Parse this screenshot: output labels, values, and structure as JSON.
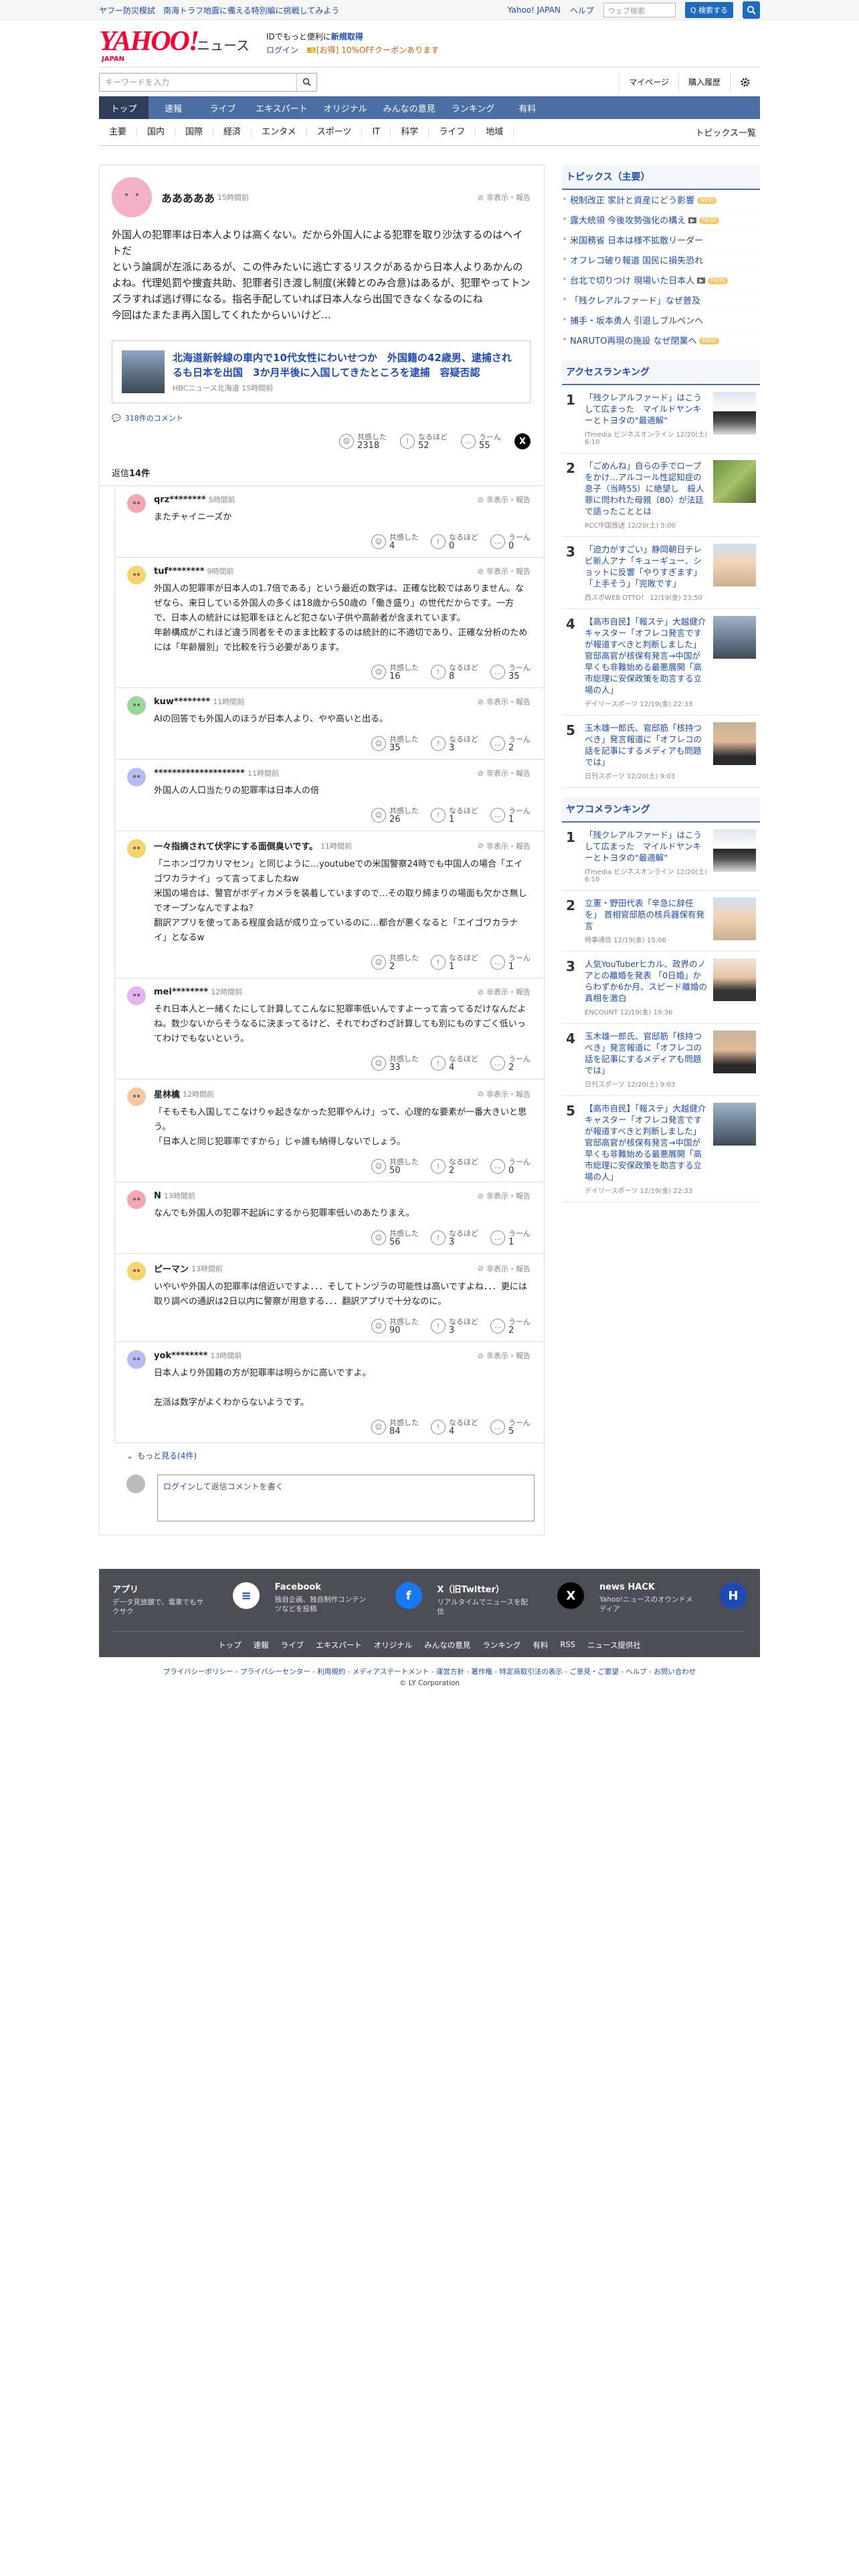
{
  "top_strip": {
    "promo_link": "ヤフー防災模試　南海トラフ地震に備える特別編に挑戦してみよう",
    "yahoo_japan": "Yahoo! JAPAN",
    "help": "ヘルプ",
    "search_placeholder": "ウェブ検索",
    "search_button": "Q 検索する"
  },
  "header": {
    "logo": "YAHOO!",
    "logo_sub": "JAPAN",
    "site": "ニュース",
    "promo_line1_prefix": "IDでもっと便利に",
    "promo_line1_link": "新規取得",
    "promo_line2_login": "ログイン",
    "promo_line2_coupon": "[お得] 10%OFFクーポンあります"
  },
  "toolbar": {
    "keyword_placeholder": "キーワードを入力",
    "mypage": "マイページ",
    "purchase_history": "購入履歴"
  },
  "global_nav": [
    "トップ",
    "速報",
    "ライブ",
    "エキスパート",
    "オリジナル",
    "みんなの意見",
    "ランキング",
    "有料"
  ],
  "sub_nav": [
    "主要",
    "国内",
    "国際",
    "経済",
    "エンタメ",
    "スポーツ",
    "IT",
    "科学",
    "ライフ",
    "地域"
  ],
  "sub_nav_topics": "トピックス一覧",
  "post": {
    "user": "あああああ",
    "time": "15時間前",
    "report": "非表示・報告",
    "text": "外国人の犯罪率は日本人よりは高くない。だから外国人による犯罪を取り沙汰するのはヘイトだ\nという論調が左派にあるが、この件みたいに逃亡するリスクがあるから日本人よりあかんのよね。代理処罰や捜査共助、犯罪者引き渡し制度(米韓とのみ合意)はあるが、犯罪やってトンズラすれば逃げ得になる。指名手配していれば日本人なら出国できなくなるのにね\n今回はたまたま再入国してくれたからいいけど…",
    "article_title": "北海道新幹線の車内で10代女性にわいせつか　外国籍の42歳男、逮捕されるも日本を出国　3か月半後に入国してきたところを逮捕　容疑否認",
    "article_source": "HBCニュース北海道 15時間前",
    "article_comments": "318件のコメント",
    "reactions": [
      {
        "label": "共感した",
        "count": "2318",
        "icon": "smile-icon"
      },
      {
        "label": "なるほど",
        "count": "52",
        "icon": "bulb-icon"
      },
      {
        "label": "うーん",
        "count": "55",
        "icon": "hmm-icon"
      }
    ]
  },
  "reply_count_label": "返信",
  "reply_count": "14件",
  "replies": [
    {
      "user": "qrz********",
      "time": "5時間前",
      "text": "またチャイニーズか",
      "counts": [
        "4",
        "0",
        "0"
      ],
      "color": "#f3a6b6"
    },
    {
      "user": "tuf********",
      "time": "9時間前",
      "text": "外国人の犯罪率が日本人の1.7倍である」という最近の数字は、正確な比較ではありません。なぜなら、来日している外国人の多くは18歳から50歳の「働き盛り」の世代だからです。一方で、日本人の統計には犯罪をほとんど犯さない子供や高齢者が含まれています。\n年齢構成がこれほど違う同者をそのまま比較するのは統計的に不適切であり、正確な分析のためには「年齢層別」で比較を行う必要があります。",
      "counts": [
        "16",
        "8",
        "35"
      ],
      "color": "#f7d36d"
    },
    {
      "user": "kuw********",
      "time": "11時間前",
      "text": "AIの回答でも外国人のほうが日本人より、やや高いと出る。",
      "counts": [
        "35",
        "3",
        "2"
      ],
      "color": "#9ad89a"
    },
    {
      "user": "********************",
      "time": "11時間前",
      "text": "外国人の人口当たりの犯罪率は日本人の倍",
      "counts": [
        "26",
        "1",
        "1"
      ],
      "color": "#b6bcf2"
    },
    {
      "user": "一々指摘されて伏字にする面倒臭いです。",
      "time": "11時間前",
      "text": "「ニホンゴワカリマセン」と同じように…youtubeでの米国警察24時でも中国人の場合「エイゴワカラナイ」って言ってましたねw\n米国の場合は、警官がボディカメラを装着していますので…その取り締まりの場面も欠かさ無しでオープンなんですよね？\n翻訳アプリを使ってある程度会話が成り立っているのに…都合が悪くなると「エイゴワカラナイ」となるw",
      "counts": [
        "2",
        "1",
        "1"
      ],
      "color": "#f7d36d"
    },
    {
      "user": "mei********",
      "time": "12時間前",
      "text": "それ日本人と一緒くたにして計算してこんなに犯罪率低いんですよーって言ってるだけなんだよね。数少ないからそうなるに決まってるけど、それでわざわざ計算しても別にものすごく低いってわけでもないという。",
      "counts": [
        "33",
        "4",
        "2"
      ],
      "color": "#e6b3f0"
    },
    {
      "user": "星林檎",
      "time": "12時間前",
      "text": "「そもそも入国してこなけりゃ起きなかった犯罪やんけ」って、心理的な要素が一番大きいと思う。\n「日本人と同じ犯罪率ですから」じゃ誰も納得しないでしょう。",
      "counts": [
        "50",
        "2",
        "0"
      ],
      "color": "#f5c9a6"
    },
    {
      "user": "N",
      "time": "13時間前",
      "text": "なんでも外国人の犯罪不起訴にするから犯罪率低いのあたりまえ。",
      "counts": [
        "56",
        "3",
        "1"
      ],
      "color": "#f3a6b6"
    },
    {
      "user": "ピーマン",
      "time": "13時間前",
      "text": "いやいや外国人の犯罪率は倍近いですよ．．．そしてトンヅラの可能性は高いですよね．．．更には取り調べの通訳は2日以内に警察が用意する．．．翻訳アプリで十分なのに。",
      "counts": [
        "90",
        "3",
        "2"
      ],
      "color": "#f7d36d"
    },
    {
      "user": "yok********",
      "time": "13時間前",
      "text": "日本人より外国籍の方が犯罪率は明らかに高いですよ。\n\n左派は数字がよくわからないようです。",
      "counts": [
        "84",
        "4",
        "5"
      ],
      "color": "#b6bcf2"
    }
  ],
  "reaction_labels": [
    "共感した",
    "なるほど",
    "うーん"
  ],
  "more_replies": "もっと見る(4件)",
  "comment_box": {
    "login": "ログイン",
    "text": "して返信コメントを書く"
  },
  "right": {
    "topics_title": "トピックス（主要）",
    "topics": [
      {
        "text": "税制改正 家計と資産にどう影響",
        "badge": "new"
      },
      {
        "text": "露大統領 今後攻勢強化の構え",
        "badge": "new-cam"
      },
      {
        "text": "米国務省 日本は様不拡散リーダー",
        "badge": ""
      },
      {
        "text": "オフレコ破り報道 国民に損失恐れ",
        "badge": ""
      },
      {
        "text": "台北で切りつけ 現場いた日本人",
        "badge": "new-cam"
      },
      {
        "text": "「残クレアルファード」なぜ普及",
        "badge": ""
      },
      {
        "text": "捕手・坂本勇人 引退しブルペンへ",
        "badge": ""
      },
      {
        "text": "NARUTO再現の施設 なぜ閉業へ",
        "badge": "new"
      }
    ],
    "access_title": "アクセスランキング",
    "access": [
      {
        "rank": "1",
        "title": "「残クレアルファード」はこうして広まった　マイルドヤンキーとトヨタの\"最適解\"",
        "src": "ITmedia ビジネスオンライン 12/20(土) 6:10",
        "img": "car"
      },
      {
        "rank": "2",
        "title": "「ごめんね」自らの手でロープをかけ…アルコール性認知症の息子（当時55）に絶望し　殺人罪に問われた母親（80）が法廷で語ったこととは",
        "src": "RCC中国放送 12/20(土) 5:00",
        "img": "green"
      },
      {
        "rank": "3",
        "title": "「迫力がすごい」静岡朝日テレビ新人アナ「キューギュー、ショットに反響「やりすぎます」「上手そう」「完敗です」",
        "src": "西スポWEB OTTO！ 12/19(金) 23:50",
        "img": "person"
      },
      {
        "rank": "4",
        "title": "【高市自民】「報ステ」大越健介キャスター「オフレコ発言ですが報道すべきと判断しました」官邸高官が核保有発言→中国が早くも非難始める最悪展開「高市総理に安保政策を助言する立場の人」",
        "src": "デイリースポーツ 12/19(金) 22:33",
        "img": "building"
      },
      {
        "rank": "5",
        "title": "玉木雄一郎氏、官邸筋「核持つべき」発言報道に「オフレコの話を記事にするメディアも問題では」",
        "src": "日刊スポーツ 12/20(土) 9:03",
        "img": "face"
      }
    ],
    "comment_title": "ヤフコメランキング",
    "comment": [
      {
        "rank": "1",
        "title": "「残クレアルファード」はこうして広まった　マイルドヤンキーとトヨタの\"最適解\"",
        "src": "ITmedia ビジネスオンライン 12/20(土) 6:10",
        "img": "car"
      },
      {
        "rank": "2",
        "title": "立憲・野田代表「辛急に辞任を」 首相官邸筋の核兵器保有発言",
        "src": "時事通信 12/19(金) 15:06",
        "img": "person"
      },
      {
        "rank": "3",
        "title": "人気YouTuberヒカル、政界のノアとの離婚を発表 「0日婚」からわずか6か月、スピード離婚の真相を激白",
        "src": "ENCOUNT 12/19(金) 19:36",
        "img": "person2"
      },
      {
        "rank": "4",
        "title": "玉木雄一郎氏、官邸筋「核持つべき」発言報道に「オフレコの話を記事にするメディアも問題では」",
        "src": "日刊スポーツ 12/20(土) 9:03",
        "img": "face"
      },
      {
        "rank": "5",
        "title": "【高市自民】「報ステ」大越健介キャスター「オフレコ発言ですが報道すべきと判断しました」官邸高官が核保有発言→中国が早くも非難始める最悪展開「高市総理に安保政策を助言する立場の人」",
        "src": "デイリースポーツ 12/19(金) 22:33",
        "img": "building"
      }
    ]
  },
  "footer": {
    "cols": [
      {
        "title": "アプリ",
        "desc": "データ見放題で、電車でもサクサク",
        "icon": "app-icon",
        "glyph": "≡"
      },
      {
        "title": "Facebook",
        "desc": "独自企画、独自制作コンテンツなどを投稿",
        "icon": "facebook-icon",
        "glyph": "f"
      },
      {
        "title": "X（旧Twitter）",
        "desc": "リアルタイムでニュースを配信",
        "icon": "x-icon",
        "glyph": "X"
      },
      {
        "title": "news HACK",
        "desc": "Yahoo!ニュースのオウンドメディア",
        "icon": "newshack-icon",
        "glyph": "H"
      }
    ],
    "links": [
      "トップ",
      "速報",
      "ライブ",
      "エキスパート",
      "オリジナル",
      "みんなの意見",
      "ランキング",
      "有料",
      "RSS",
      "ニュース提供社"
    ],
    "legal": "プライバシーポリシー - プライバシーセンター - 利用規約 - メディアステートメント - 運営方針 - 著作権 - 特定商取引法の表示 - ご意見・ご要望 - ヘルプ - お問い合わせ",
    "copyright": "© LY Corporation"
  },
  "colors": {
    "accent": "#1c4bb5",
    "nav": "#4a6fa5",
    "nav_active": "#2e3d5a",
    "footer": "#4b4f55"
  }
}
